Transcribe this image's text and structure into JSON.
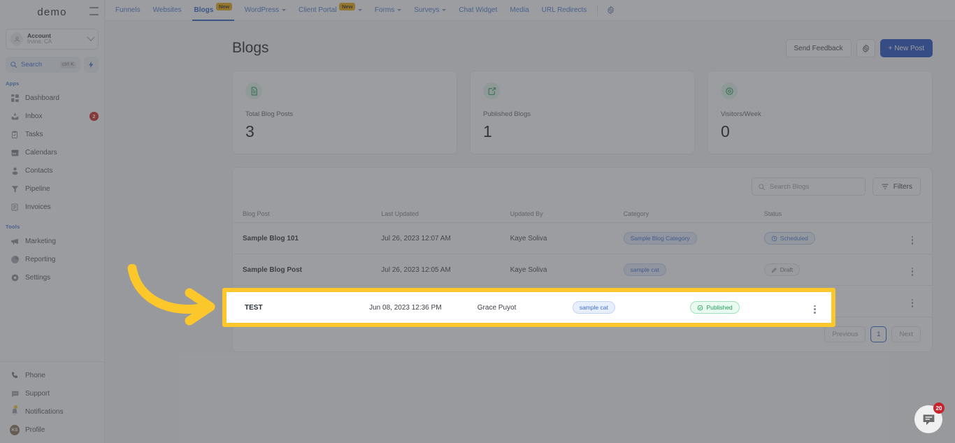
{
  "sidebar": {
    "brand": "demo",
    "collapse_icon": "hamburger-collapse-icon",
    "account": {
      "name": "Account",
      "location": "Irvine, CA",
      "avatar_icon": "user-circle-icon",
      "chevron_icon": "chevron-down-icon"
    },
    "search": {
      "label": "Search",
      "shortcut": "ctrl K",
      "icon": "search-icon",
      "bolt_icon": "lightning-bolt-icon"
    },
    "sections": [
      {
        "label": "Apps",
        "items": [
          {
            "label": "Dashboard",
            "icon": "grid-dashboard-icon"
          },
          {
            "label": "Inbox",
            "icon": "inbox-icon",
            "badge": "2"
          },
          {
            "label": "Tasks",
            "icon": "clipboard-check-icon"
          },
          {
            "label": "Calendars",
            "icon": "calendar-icon"
          },
          {
            "label": "Contacts",
            "icon": "person-icon"
          },
          {
            "label": "Pipeline",
            "icon": "funnel-pipeline-icon"
          },
          {
            "label": "Invoices",
            "icon": "invoice-document-icon"
          }
        ]
      },
      {
        "label": "Tools",
        "items": [
          {
            "label": "Marketing",
            "icon": "megaphone-icon"
          },
          {
            "label": "Reporting",
            "icon": "pie-chart-icon"
          },
          {
            "label": "Settings",
            "icon": "gear-icon"
          }
        ]
      }
    ],
    "bottom_items": [
      {
        "label": "Phone",
        "icon": "phone-icon"
      },
      {
        "label": "Support",
        "icon": "chat-support-icon"
      },
      {
        "label": "Notifications",
        "icon": "bell-icon",
        "dot": true
      },
      {
        "label": "Profile",
        "icon": "avatar-icon",
        "initials": "KS"
      }
    ]
  },
  "topbar": {
    "tabs": [
      {
        "label": "Funnels",
        "active": false,
        "badge": null,
        "caret": false
      },
      {
        "label": "Websites",
        "active": false,
        "badge": null,
        "caret": false
      },
      {
        "label": "Blogs",
        "active": true,
        "badge": "New",
        "caret": false
      },
      {
        "label": "WordPress",
        "active": false,
        "badge": null,
        "caret": true
      },
      {
        "label": "Client Portal",
        "active": false,
        "badge": "New",
        "caret": true
      },
      {
        "label": "Forms",
        "active": false,
        "badge": null,
        "caret": true
      },
      {
        "label": "Surveys",
        "active": false,
        "badge": null,
        "caret": true
      },
      {
        "label": "Chat Widget",
        "active": false,
        "badge": null,
        "caret": false
      },
      {
        "label": "Media",
        "active": false,
        "badge": null,
        "caret": false
      },
      {
        "label": "URL Redirects",
        "active": false,
        "badge": null,
        "caret": false
      }
    ],
    "settings_icon": "gear-icon"
  },
  "page": {
    "title": "Blogs",
    "send_feedback_label": "Send Feedback",
    "settings_icon": "gear-icon",
    "new_post_label": "+ New Post"
  },
  "stats": [
    {
      "label": "Total Blog Posts",
      "value": "3",
      "icon": "file-text-icon"
    },
    {
      "label": "Published Blogs",
      "value": "1",
      "icon": "image-send-icon"
    },
    {
      "label": "Visitors/Week",
      "value": "0",
      "icon": "eye-target-icon"
    }
  ],
  "toolbar": {
    "search_placeholder": "Search Blogs",
    "search_value": "",
    "search_icon": "search-icon",
    "filters_label": "Filters",
    "filters_icon": "filter-lines-icon"
  },
  "table": {
    "columns": [
      "Blog Post",
      "Last Updated",
      "Updated By",
      "Category",
      "Status",
      ""
    ],
    "rows": [
      {
        "post": "Sample Blog 101",
        "updated": "Jul 26, 2023 12:07 AM",
        "by": "Kaye Soliva",
        "category": "Sample Blog Category",
        "status": "Scheduled",
        "status_type": "scheduled",
        "status_icon": "clock-icon",
        "menu_icon": "kebab-menu-icon"
      },
      {
        "post": "Sample Blog Post",
        "updated": "Jul 26, 2023 12:05 AM",
        "by": "Kaye Soliva",
        "category": "sample cat",
        "status": "Draft",
        "status_type": "draft",
        "status_icon": "pencil-icon",
        "menu_icon": "kebab-menu-icon"
      },
      {
        "post": "TEST",
        "updated": "Jun 08, 2023 12:36 PM",
        "by": "Grace Puyot",
        "category": "sample cat",
        "status": "Published",
        "status_type": "published",
        "status_icon": "check-circle-icon",
        "menu_icon": "kebab-menu-icon"
      }
    ]
  },
  "pagination": {
    "previous_label": "Previous",
    "current_page": "1",
    "next_label": "Next"
  },
  "annotation": {
    "arrow_icon": "curved-arrow-icon",
    "arrow_color": "#fcc72b",
    "highlight_color": "#fcc72b"
  },
  "chat": {
    "icon": "chat-bubble-icon",
    "badge": "20"
  },
  "colors": {
    "accent_blue": "#2b5fc4",
    "primary_button": "#1b4cc4",
    "highlight_yellow": "#fcc72b",
    "badge_red": "#d11f1f",
    "success_green": "#1f9d58"
  }
}
